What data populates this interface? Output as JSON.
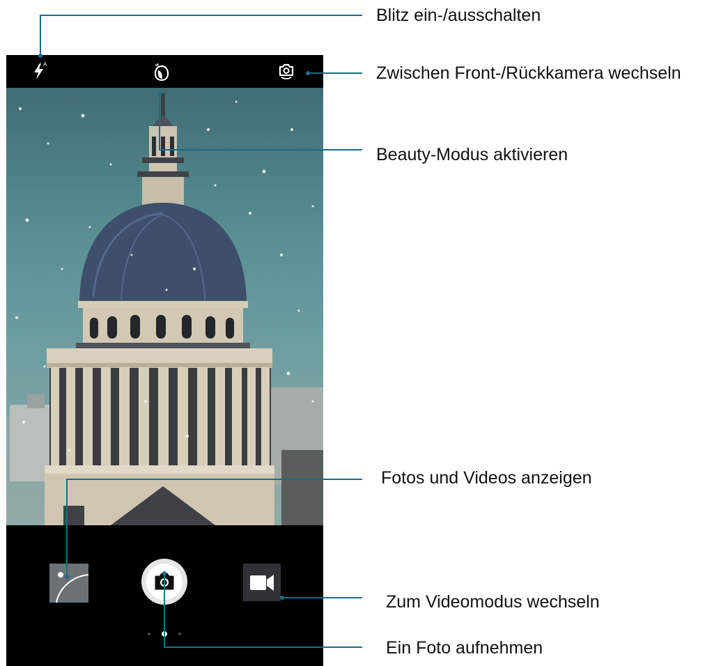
{
  "callouts": {
    "flash": "Blitz ein-/ausschalten",
    "switch_camera": "Zwischen Front-/Rückkamera wechseln",
    "beauty": "Beauty-Modus aktivieren",
    "gallery": "Fotos und Videos anzeigen",
    "video_mode": "Zum Videomodus wechseln",
    "shutter": "Ein Foto aufnehmen"
  },
  "topbar": {
    "flash_mode_badge": "A",
    "icons": [
      "flash-auto-icon",
      "beauty-mode-icon",
      "switch-camera-icon"
    ]
  },
  "bottombar": {
    "icons": [
      "gallery-thumbnail-icon",
      "camera-icon",
      "video-camera-icon"
    ],
    "mode_pages": 3,
    "active_mode_page": 2
  },
  "colors": {
    "callout_line": "#1a6d86",
    "ui_background": "#000000",
    "shutter_ring": "#e6e6e6"
  }
}
